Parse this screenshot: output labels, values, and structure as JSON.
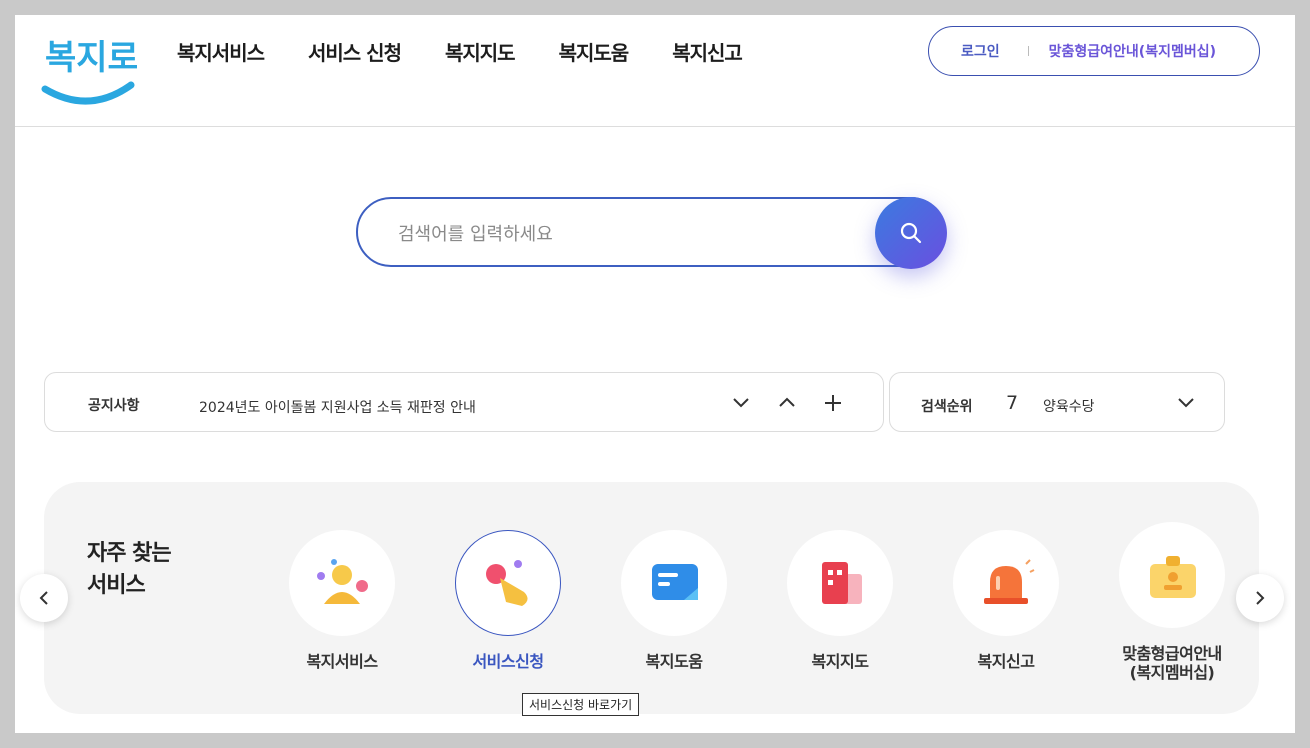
{
  "header": {
    "logo_text": "복지로",
    "nav": [
      "복지서비스",
      "서비스 신청",
      "복지지도",
      "복지도움",
      "복지신고"
    ],
    "login_label": "로그인",
    "member_label": "맞춤형급여안내(복지멤버십)"
  },
  "search": {
    "placeholder": "검색어를 입력하세요",
    "button_icon": "search-icon"
  },
  "notice": {
    "label": "공지사항",
    "text": "2024년도 아이돌봄 지원사업 소득 재판정 안내",
    "controls": [
      "chevron-down-icon",
      "chevron-up-icon",
      "plus-icon"
    ]
  },
  "rank": {
    "label": "검색순위",
    "number": "7",
    "term": "양육수당"
  },
  "services": {
    "title_line1": "자주 찾는",
    "title_line2": "서비스",
    "items": [
      {
        "line1": "복지서비스",
        "line2": "",
        "icon": "person-icon"
      },
      {
        "line1": "서비스신청",
        "line2": "",
        "icon": "hand-tap-icon"
      },
      {
        "line1": "복지도움",
        "line2": "",
        "icon": "chat-icon"
      },
      {
        "line1": "복지지도",
        "line2": "",
        "icon": "building-icon"
      },
      {
        "line1": "복지신고",
        "line2": "",
        "icon": "siren-icon"
      },
      {
        "line1": "맞춤형급여안내",
        "line2": "(복지멤버십)",
        "icon": "id-card-icon"
      }
    ],
    "active_index": 1
  },
  "tooltip": "서비스신청 바로가기",
  "colors": {
    "accent": "#3a56c0",
    "search_btn_start": "#3b7be0",
    "search_btn_end": "#6a4fe0",
    "logo": "#2aa7e0"
  }
}
